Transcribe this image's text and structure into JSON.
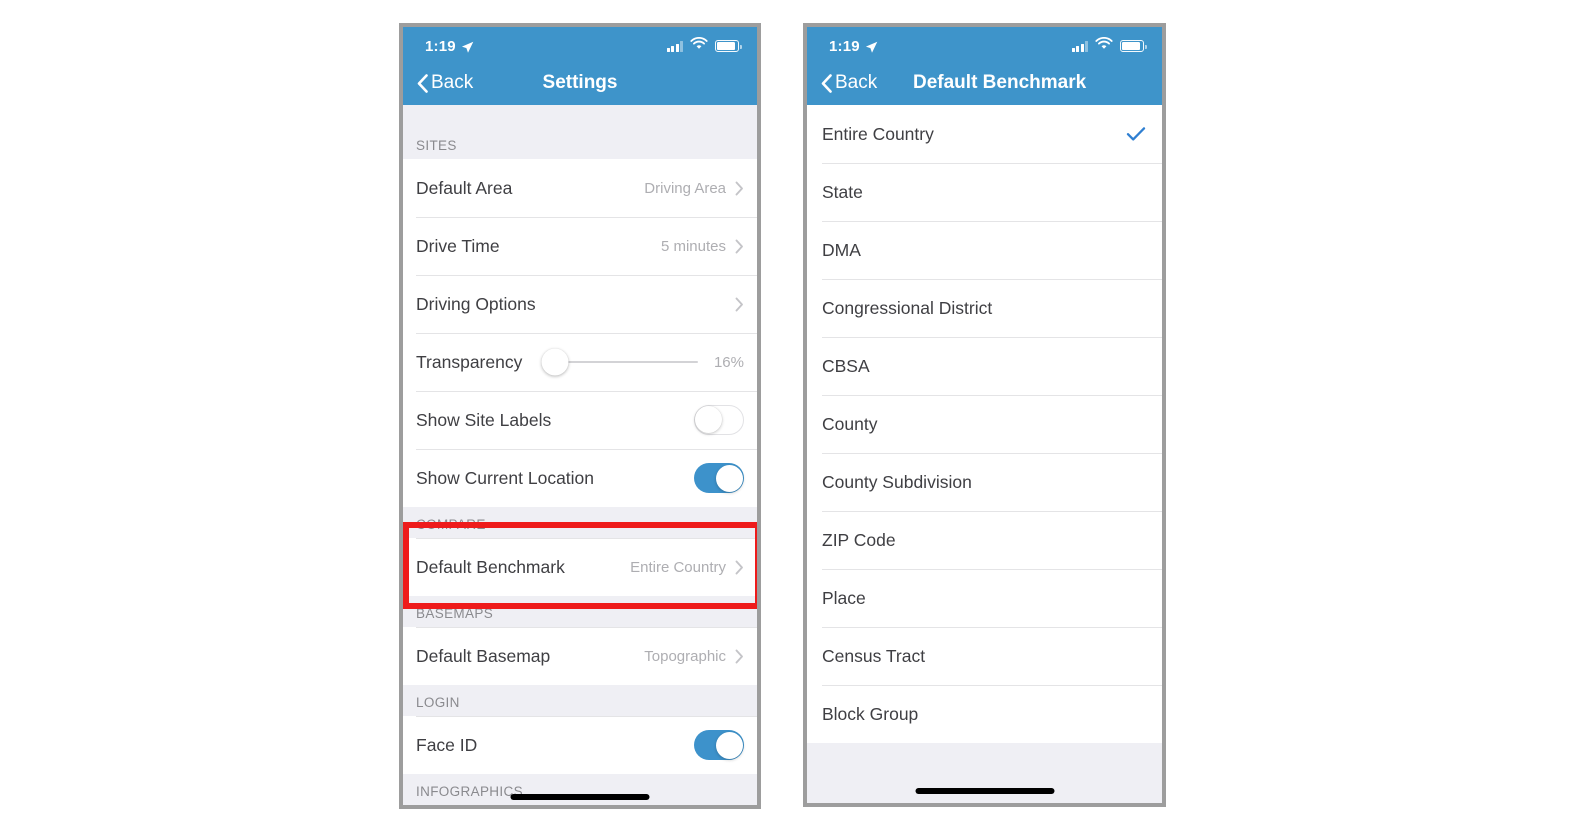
{
  "colors": {
    "accent_blue": "#3e94ca",
    "toggle_on": "#3d92cb",
    "checkmark": "#2f7fd1",
    "highlight_red": "#ee1b1b",
    "section_bg": "#efeff4",
    "value_grey": "#aeaeb2",
    "label_dark": "#3f3f43"
  },
  "left_phone": {
    "status_bar": {
      "time": "1:19",
      "location_icon": "location-arrow-icon",
      "signal_icon": "cellular-signal-icon",
      "wifi_icon": "wifi-icon",
      "battery_icon": "battery-icon"
    },
    "nav": {
      "back_label": "Back",
      "back_icon": "chevron-left-icon",
      "title": "Settings"
    },
    "sections": [
      {
        "header": "SITES",
        "rows": [
          {
            "label": "Default Area",
            "value": "Driving Area",
            "type": "disclosure"
          },
          {
            "label": "Drive Time",
            "value": "5 minutes",
            "type": "disclosure"
          },
          {
            "label": "Driving Options",
            "value": "",
            "type": "disclosure"
          },
          {
            "label": "Transparency",
            "value": "16%",
            "type": "slider"
          },
          {
            "label": "Show Site Labels",
            "value": "off",
            "type": "toggle"
          },
          {
            "label": "Show Current Location",
            "value": "on",
            "type": "toggle"
          }
        ]
      },
      {
        "header": "COMPARE",
        "highlighted": true,
        "rows": [
          {
            "label": "Default Benchmark",
            "value": "Entire Country",
            "type": "disclosure"
          }
        ]
      },
      {
        "header": "BASEMAPS",
        "rows": [
          {
            "label": "Default Basemap",
            "value": "Topographic",
            "type": "disclosure"
          }
        ]
      },
      {
        "header": "LOGIN",
        "rows": [
          {
            "label": "Face ID",
            "value": "on",
            "type": "toggle"
          }
        ]
      },
      {
        "header": "INFOGRAPHICS",
        "rows": []
      }
    ]
  },
  "right_phone": {
    "status_bar": {
      "time": "1:19",
      "location_icon": "location-arrow-icon",
      "signal_icon": "cellular-signal-icon",
      "wifi_icon": "wifi-icon",
      "battery_icon": "battery-icon"
    },
    "nav": {
      "back_label": "Back",
      "back_icon": "chevron-left-icon",
      "title": "Default Benchmark"
    },
    "options": [
      {
        "label": "Entire Country",
        "selected": true
      },
      {
        "label": "State",
        "selected": false
      },
      {
        "label": "DMA",
        "selected": false
      },
      {
        "label": "Congressional District",
        "selected": false
      },
      {
        "label": "CBSA",
        "selected": false
      },
      {
        "label": "County",
        "selected": false
      },
      {
        "label": "County Subdivision",
        "selected": false
      },
      {
        "label": "ZIP Code",
        "selected": false
      },
      {
        "label": "Place",
        "selected": false
      },
      {
        "label": "Census Tract",
        "selected": false
      },
      {
        "label": "Block Group",
        "selected": false
      }
    ]
  }
}
